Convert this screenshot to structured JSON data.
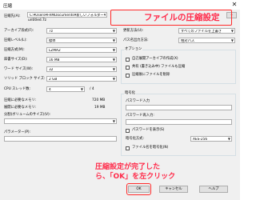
{
  "window": {
    "title": "圧縮",
    "close_glyph": "✕"
  },
  "archive": {
    "label": "圧縮先(A):",
    "path": "C:¥Users¥FRMDocuments¥新しいフォルダー¥",
    "filename": "untitled.7z",
    "browse_label": "..."
  },
  "left": {
    "fields": [
      {
        "label": "アーカイブ形式(F):",
        "value": "7z"
      },
      {
        "label": "圧縮レベル(L):",
        "value": "標準"
      },
      {
        "label": "圧縮方式(M):",
        "value": "LZMA2"
      },
      {
        "label": "辞書サイズ(D):",
        "value": "16 MB"
      },
      {
        "label": "ワード サイズ(W):",
        "value": "32"
      },
      {
        "label": "ソリッド ブロック サイズ:",
        "value": "2 GB"
      },
      {
        "label": "CPU スレッド数:",
        "value": "4",
        "extra": "/ 4"
      }
    ],
    "mem_compress_label": "圧縮に必要なメモリ:",
    "mem_compress_value": "720 MB",
    "mem_decompress_label": "展開に必要なメモリ:",
    "mem_decompress_value": "19 MB",
    "split_label": "分割(ボリュームのサイズ)(V):",
    "params_label": "パラメーター(P):"
  },
  "right": {
    "update_label": "更新方法(U):",
    "update_value": "すべてのファイルを上書き",
    "pathmode_label": "パス名出力方法:",
    "pathmode_value": "相対パス",
    "options_title": "オプション",
    "options": [
      "自己展開アーカイブの作成(X)",
      "共有 (書き込み中) ファイルも圧縮",
      "圧縮後にファイルを削除"
    ],
    "encryption_title": "暗号化",
    "password_label": "パスワード入力",
    "password_confirm_label": "パスワード再入力:",
    "show_password_label": "パスワードを表示(S)",
    "enc_method_label": "暗号化方式:",
    "enc_method_value": "AES-256",
    "enc_filenames_label": "ファイル名を暗号化(N)"
  },
  "buttons": {
    "ok": "OK",
    "cancel": "キャンセル",
    "help": "ヘルプ"
  },
  "annotations": {
    "title": "ファイルの圧縮設定",
    "note_line1": "圧縮設定が完了した",
    "note_line2": "ら、「OK」を左クリック",
    "color": "#ff2b4a"
  }
}
